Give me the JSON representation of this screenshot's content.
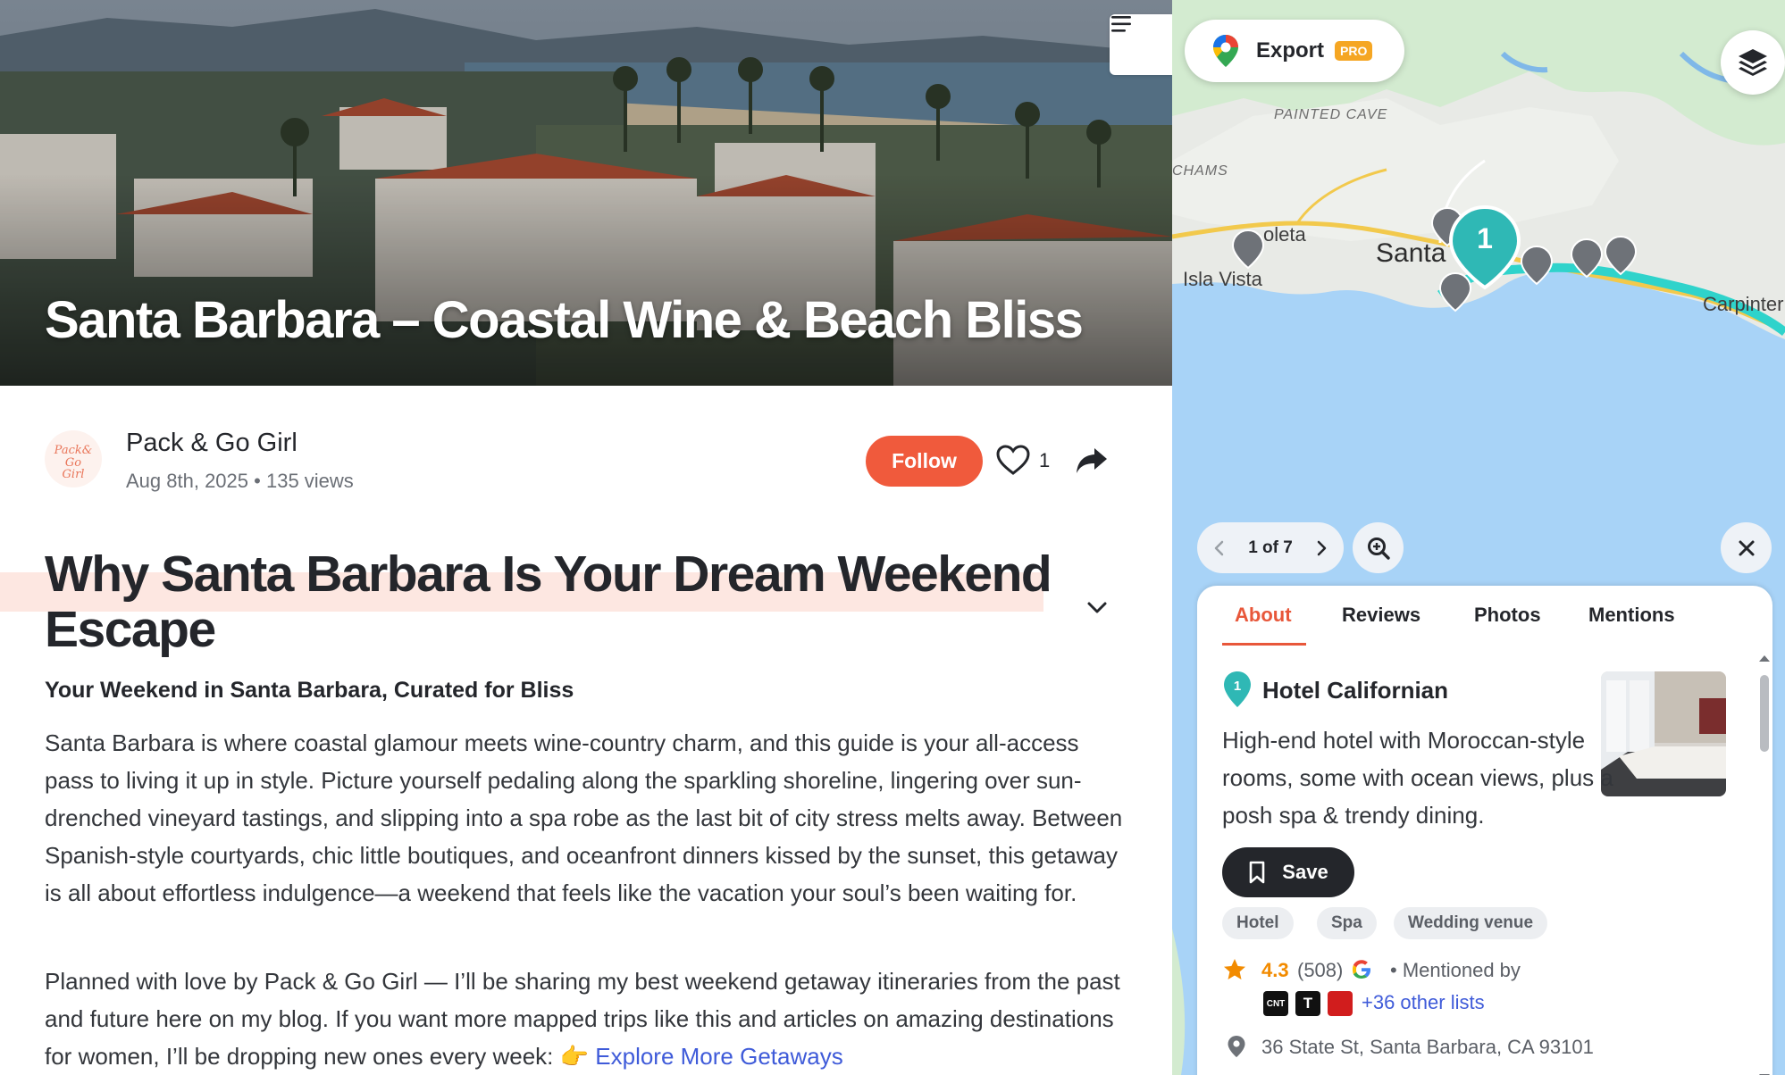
{
  "hero": {
    "title": "Santa Barbara – Coastal Wine & Beach Bliss"
  },
  "author": {
    "name": "Pack & Go Girl",
    "avatar_text": "Pack & Go Girl",
    "date": "Aug 8th, 2025",
    "views": "135 views",
    "follow_label": "Follow",
    "like_count": "1"
  },
  "article": {
    "section_title": "Why Santa Barbara Is Your Dream Weekend Escape",
    "subheading": "Your Weekend in Santa Barbara, Curated for Bliss",
    "paragraph1": "Santa Barbara is where coastal glamour meets wine-country charm, and this guide is your all-access pass to living it up in style. Picture yourself pedaling along the sparkling shoreline, lingering over sun-drenched vineyard tastings, and slipping into a spa robe as the last bit of city stress melts away. Between Spanish-style courtyards, chic little boutiques, and oceanfront dinners kissed by the sunset, this getaway is all about effortless indulgence—a weekend that feels like the vacation your soul’s been waiting for.",
    "paragraph2": "Planned with love by Pack & Go Girl — I’ll be sharing my best weekend getaway itineraries from the past and future here on my blog. If you want more mapped trips like this and articles on amazing destinations for women, I’ll be dropping new ones every week:",
    "pointing_emoji": "👉",
    "link_text": "Explore More Getaways"
  },
  "map": {
    "export_label": "Export",
    "pro_badge": "PRO",
    "labels": {
      "painted_cave": "PAINTED CAVE",
      "chams": "CHAMS",
      "goleta": "oleta",
      "isla_vista": "Isla Vista",
      "santa": "Santa",
      "carpinteria": "Carpinter"
    },
    "selected_marker": "1",
    "pager": {
      "text": "1 of 7"
    }
  },
  "place": {
    "tabs": [
      "About",
      "Reviews",
      "Photos",
      "Mentions"
    ],
    "active_tab": "About",
    "marker_number": "1",
    "name": "Hotel Californian",
    "description": "High-end hotel with Moroccan-style rooms, some with ocean views, plus a posh spa & trendy dining.",
    "save_label": "Save",
    "tags": [
      "Hotel",
      "Spa",
      "Wedding venue"
    ],
    "rating": "4.3",
    "review_count": "(508)",
    "mentioned_by": "• Mentioned by",
    "mention_logos": [
      "CNT",
      "T",
      ""
    ],
    "other_lists": "+36 other lists",
    "address": "36 State St, Santa Barbara, CA 93101"
  },
  "colors": {
    "accent": "#f05a3c",
    "link": "#3f5bd9",
    "marker_teal": "#2fb8b5",
    "rating_orange": "#f28b00",
    "ocean": "#a8d3f7"
  }
}
